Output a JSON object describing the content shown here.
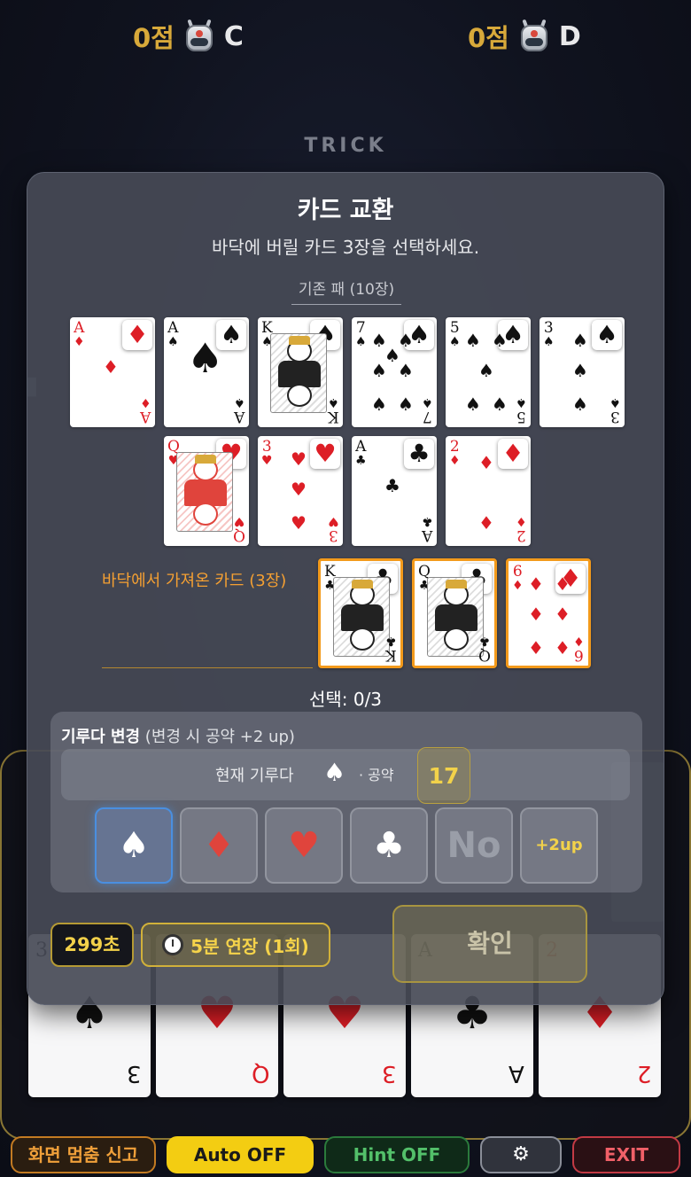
{
  "players": {
    "c": {
      "score": "0점",
      "name": "C"
    },
    "d": {
      "score": "0점",
      "name": "D"
    }
  },
  "trick": {
    "label": "TRICK"
  },
  "modal": {
    "title": "카드 교환",
    "subtitle": "바닥에 버릴 카드 3장을 선택하세요.",
    "hand_label": "기존 패 (10장)",
    "hand": [
      {
        "rank": "A",
        "suit": "♦",
        "color": "red"
      },
      {
        "rank": "A",
        "suit": "♠",
        "color": "black"
      },
      {
        "rank": "K",
        "suit": "♠",
        "color": "black"
      },
      {
        "rank": "7",
        "suit": "♠",
        "color": "black"
      },
      {
        "rank": "5",
        "suit": "♠",
        "color": "black"
      },
      {
        "rank": "3",
        "suit": "♠",
        "color": "black"
      },
      {
        "rank": "Q",
        "suit": "♥",
        "color": "red"
      },
      {
        "rank": "3",
        "suit": "♥",
        "color": "red"
      },
      {
        "rank": "A",
        "suit": "♣",
        "color": "black"
      },
      {
        "rank": "2",
        "suit": "♦",
        "color": "red"
      }
    ],
    "drawn_label": "바닥에서 가져온 카드 (3장)",
    "drawn": [
      {
        "rank": "K",
        "suit": "♣",
        "color": "black"
      },
      {
        "rank": "Q",
        "suit": "♣",
        "color": "black"
      },
      {
        "rank": "6",
        "suit": "♦",
        "color": "red"
      }
    ],
    "selection": "선택: 0/3",
    "trump": {
      "heading_bold": "기루다 변경",
      "heading_note": " (변경 시 공약 +2 up)",
      "current_label": "현재 기루다",
      "current_suit": "♠",
      "bid_label": "· 공약",
      "bid_value": "17",
      "options": [
        {
          "label": "♠",
          "color": "#ffffff",
          "active": true
        },
        {
          "label": "♦",
          "color": "#e0443c",
          "active": false
        },
        {
          "label": "♥",
          "color": "#e0443c",
          "active": false
        },
        {
          "label": "♣",
          "color": "#ffffff",
          "active": false
        },
        {
          "label": "No",
          "color": "#9a9ea8",
          "active": false
        },
        {
          "label": "+2up",
          "color": "#f2d24a",
          "active": false
        }
      ]
    },
    "timer": "299초",
    "extend": "5분 연장 (1회)",
    "confirm": "확인"
  },
  "background_hand": [
    {
      "rank": "3",
      "suit": "♠",
      "color": "black"
    },
    {
      "rank": "Q",
      "suit": "♥",
      "color": "red"
    },
    {
      "rank": "3",
      "suit": "♥",
      "color": "red"
    },
    {
      "rank": "A",
      "suit": "♣",
      "color": "black"
    },
    {
      "rank": "2",
      "suit": "♦",
      "color": "red"
    }
  ],
  "bottom_bar": {
    "report": "화면 멈춤 신고",
    "auto": "Auto OFF",
    "hint": "Hint OFF",
    "settings_icon": "⚙",
    "exit": "EXIT"
  },
  "colors": {
    "accent_gold": "#d8a93a",
    "selected_border": "#f39a1b",
    "active_suit": "#4a8fe0"
  }
}
